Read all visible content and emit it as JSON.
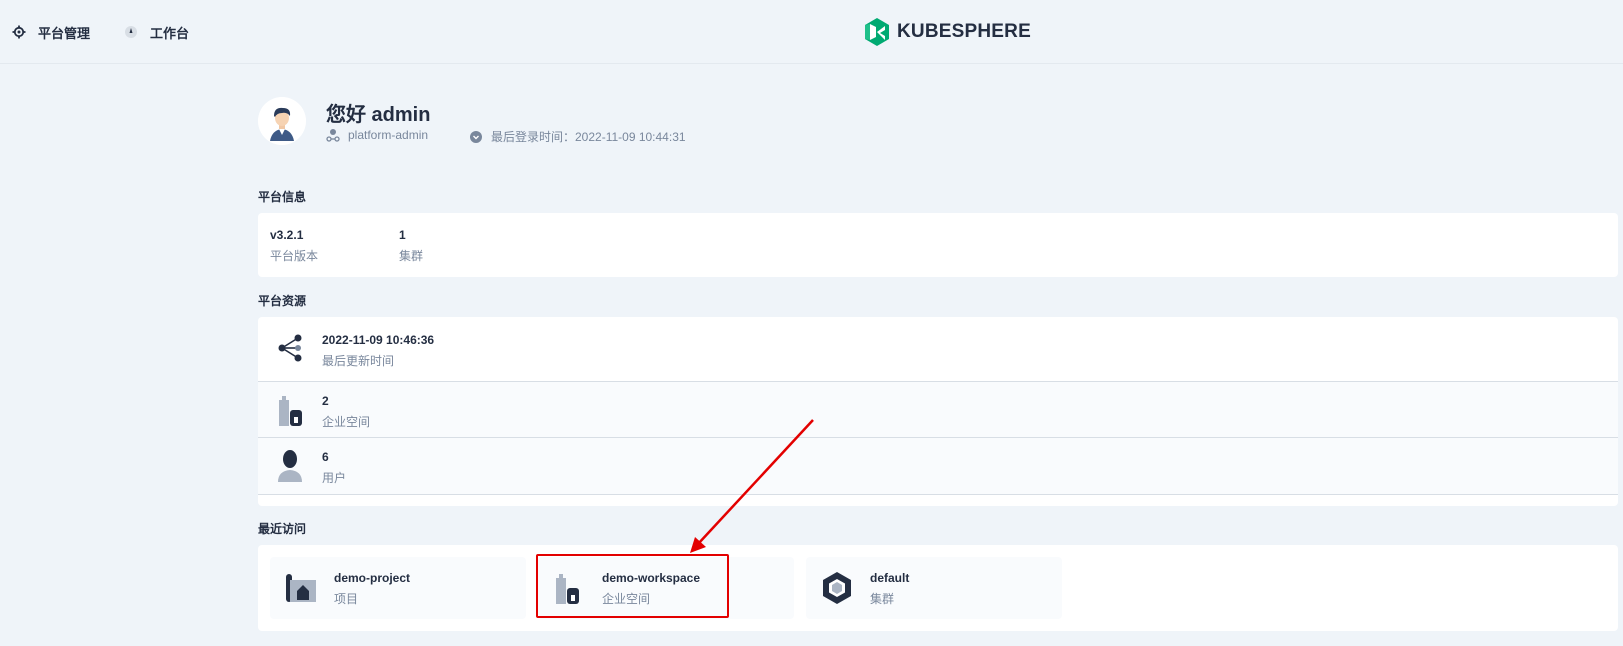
{
  "nav": {
    "platform_label": "平台管理",
    "workbench_label": "工作台"
  },
  "logo": {
    "text": "KUBESPHERE"
  },
  "greeting": {
    "title": "您好 admin",
    "role": "platform-admin",
    "last_login": "最后登录时间：2022-11-09 10:44:31"
  },
  "platform_info": {
    "title": "平台信息",
    "items": [
      {
        "value": "v3.2.1",
        "label": "平台版本"
      },
      {
        "value": "1",
        "label": "集群"
      }
    ]
  },
  "platform_resources": {
    "title": "平台资源",
    "rows": [
      {
        "icon": "update-time-icon",
        "value": "2022-11-09 10:46:36",
        "label": "最后更新时间"
      },
      {
        "icon": "workspace-icon",
        "value": "2",
        "label": "企业空间"
      },
      {
        "icon": "user-icon",
        "value": "6",
        "label": "用户"
      }
    ]
  },
  "recent": {
    "title": "最近访问",
    "items": [
      {
        "icon": "project-icon",
        "name": "demo-project",
        "type": "项目"
      },
      {
        "icon": "workspace-icon",
        "name": "demo-workspace",
        "type": "企业空间"
      },
      {
        "icon": "cluster-icon",
        "name": "default",
        "type": "集群"
      }
    ]
  },
  "colors": {
    "accent_green": "#00aa72",
    "annotation_red": "#e30000",
    "text_primary": "#242e42",
    "text_secondary": "#79879c"
  }
}
